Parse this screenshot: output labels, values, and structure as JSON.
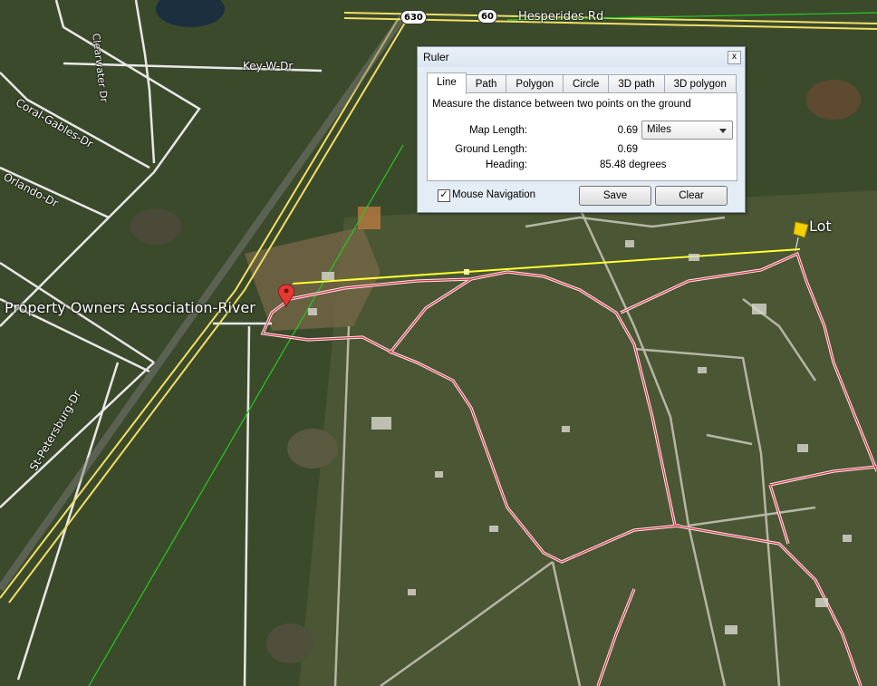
{
  "map": {
    "road_labels": {
      "clearwater": "Clearwater Dr",
      "key_w": "Key-W-Dr",
      "coral_gables": "Coral-Gables-Dr",
      "orlando": "Orlando-Dr",
      "st_petersburg": "St-Petersburg-Dr",
      "hesperides": "Hesperides Rd"
    },
    "shields": {
      "sr630": "630",
      "sr60": "60"
    },
    "places": {
      "poa": "Property Owners Association-River",
      "lot": "Lot"
    },
    "colors": {
      "measure_line": "#ffff33",
      "boundary": "#e0384b",
      "green_line": "#22cc22",
      "road_white": "#ffffff",
      "road_yellow": "#f5e663"
    }
  },
  "ruler": {
    "title": "Ruler",
    "close": "x",
    "tabs": [
      "Line",
      "Path",
      "Polygon",
      "Circle",
      "3D path",
      "3D polygon"
    ],
    "active_tab": "Line",
    "description": "Measure the distance between two points on the ground",
    "map_length_label": "Map Length:",
    "map_length_value": "0.69",
    "unit": "Miles",
    "ground_length_label": "Ground Length:",
    "ground_length_value": "0.69",
    "heading_label": "Heading:",
    "heading_value": "85.48 degrees",
    "mouse_nav_label": "Mouse Navigation",
    "mouse_nav_checked": "✓",
    "save_label": "Save",
    "clear_label": "Clear"
  }
}
